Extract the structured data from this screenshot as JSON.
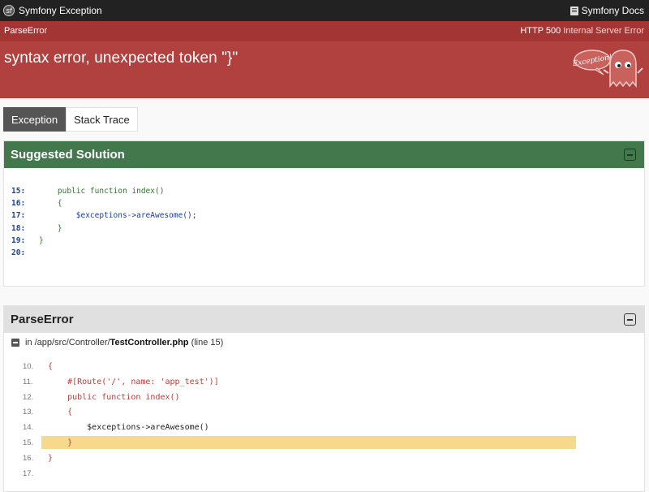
{
  "topbar": {
    "app_title": "Symfony Exception",
    "docs_label": "Symfony Docs",
    "logo_icon": "symfony-logo-icon",
    "docs_icon": "book-icon"
  },
  "header": {
    "exception_class": "ParseError",
    "status_code": "HTTP 500",
    "status_text": "Internal Server Error",
    "message": "syntax error, unexpected token \"}\"",
    "mascot_bubble_text": "Exception!",
    "bg_color": "#b0413e"
  },
  "tabs": [
    {
      "label": "Exception",
      "active": true
    },
    {
      "label": "Stack Trace",
      "active": false
    }
  ],
  "solution": {
    "title": "Suggested Solution",
    "lines": [
      {
        "num": "15:",
        "code": "    public function index()"
      },
      {
        "num": "16:",
        "code": "    {"
      },
      {
        "num": "17:",
        "code": "        $exceptions->areAwesome();"
      },
      {
        "num": "18:",
        "code": "    }"
      },
      {
        "num": "19:",
        "code": "}"
      },
      {
        "num": "20:",
        "code": ""
      }
    ]
  },
  "error": {
    "title": "ParseError",
    "file_prefix": "in /app/src/Controller/",
    "file_name": "TestController.php",
    "file_suffix": "(line 15)",
    "highlight_line": "15.",
    "lines": [
      {
        "num": "10.",
        "code": "{"
      },
      {
        "num": "11.",
        "code": "    #[Route('/', name: 'app_test')]"
      },
      {
        "num": "12.",
        "code": "    public function index()"
      },
      {
        "num": "13.",
        "code": "    {"
      },
      {
        "num": "14.",
        "code": "        $exceptions->areAwesome()"
      },
      {
        "num": "15.",
        "code": "    }"
      },
      {
        "num": "16.",
        "code": "}"
      },
      {
        "num": "17.",
        "code": ""
      }
    ]
  }
}
